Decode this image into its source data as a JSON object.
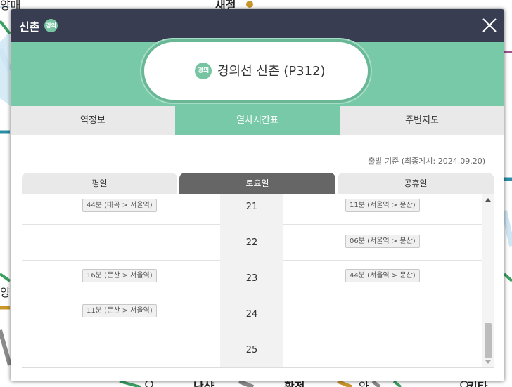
{
  "map": {
    "labels": [
      "양매",
      "새절",
      "양",
      "난샹",
      "확전",
      "양",
      "키타"
    ],
    "colors": {
      "green": "#3a9f62",
      "gray": "#8a8a8a",
      "teal": "#2a8fa6",
      "gold": "#c9962a",
      "purple": "#a0548f",
      "light_blue": "#cfe6f4"
    }
  },
  "header": {
    "title": "신촌",
    "badge": "경의",
    "close_icon": "close-icon"
  },
  "station": {
    "badge": "경의",
    "name": "경의선 신촌 (P312)"
  },
  "tabs": [
    {
      "label": "역정보",
      "active": false
    },
    {
      "label": "열차시간표",
      "active": true
    },
    {
      "label": "주변지도",
      "active": false
    }
  ],
  "subtitle": "출발 기준 (최종게시: 2024.09.20)",
  "day_tabs": [
    {
      "label": "평일",
      "active": false
    },
    {
      "label": "토요일",
      "active": true
    },
    {
      "label": "공휴일",
      "active": false
    }
  ],
  "timetable": [
    {
      "hour": "21",
      "left": "44분 (대곡 > 서울역)",
      "right": "11분 (서울역 > 문산)"
    },
    {
      "hour": "22",
      "left": "",
      "right": "06분 (서울역 > 문산)"
    },
    {
      "hour": "23",
      "left": "16분 (문산 > 서울역)",
      "right": "44분 (서울역 > 문산)"
    },
    {
      "hour": "24",
      "left": "11분 (문산 > 서울역)",
      "right": ""
    },
    {
      "hour": "25",
      "left": "",
      "right": ""
    }
  ],
  "colors": {
    "header_bg": "#383d52",
    "accent_green": "#77c9a7",
    "active_day_tab": "#666666",
    "inactive_tab": "#e9e9e9"
  }
}
